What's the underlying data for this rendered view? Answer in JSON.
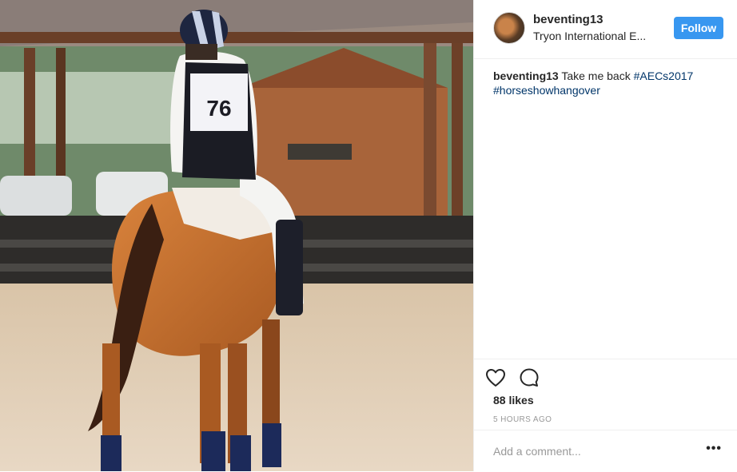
{
  "post": {
    "username": "beventing13",
    "location": "Tryon International E...",
    "follow_label": "Follow",
    "caption": {
      "username": "beventing13",
      "text": "Take me back",
      "hashtags": [
        "#AECs2017",
        "#horseshowhangover"
      ]
    },
    "likes": "88 likes",
    "time": "5 HOURS AGO",
    "comment_placeholder": "Add a comment...",
    "more_label": "•••",
    "photo": {
      "bib_number": "76"
    }
  },
  "icons": [
    "heart-icon",
    "comment-icon"
  ],
  "colors": {
    "follow": "#3897f0",
    "hashtag": "#003569",
    "muted": "#999999"
  }
}
